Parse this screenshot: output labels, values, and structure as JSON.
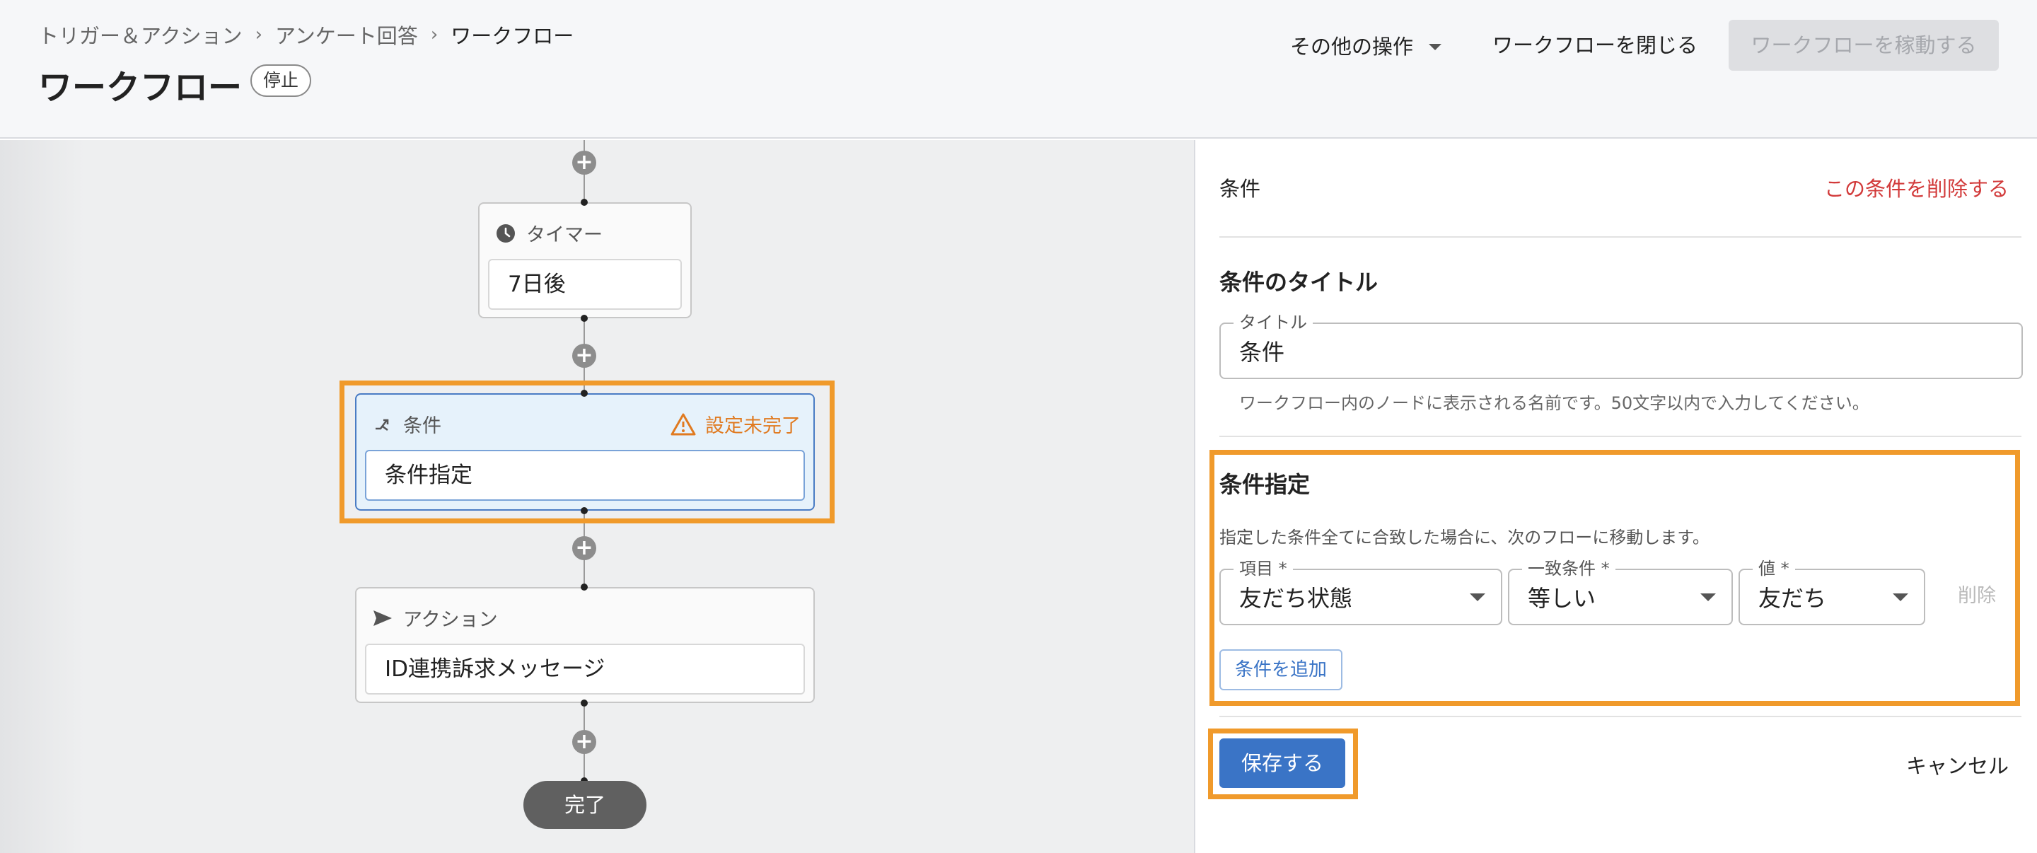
{
  "header": {
    "breadcrumb": [
      "トリガー＆アクション",
      "アンケート回答",
      "ワークフロー"
    ],
    "breadcrumb_separator": "›",
    "title": "ワークフロー",
    "status": "停止",
    "other_actions": "その他の操作",
    "close_workflow": "ワークフローを閉じる",
    "run_workflow": "ワークフローを稼動する"
  },
  "canvas": {
    "timer_node": {
      "type_label": "タイマー",
      "value": "7日後"
    },
    "condition_node": {
      "type_label": "条件",
      "warning": "設定未完了",
      "value": "条件指定"
    },
    "action_node": {
      "type_label": "アクション",
      "value": "ID連携訴求メッセージ"
    },
    "end_label": "完了",
    "add_symbol": "+"
  },
  "panel": {
    "label": "条件",
    "delete_condition": "この条件を削除する",
    "title_section": {
      "heading": "条件のタイトル",
      "field_legend": "タイトル",
      "field_value": "条件",
      "helper": "ワークフロー内のノードに表示される名前です。50文字以内で入力してください。"
    },
    "spec_section": {
      "heading": "条件指定",
      "description": "指定した条件全てに合致した場合に、次のフローに移動します。",
      "item_legend": "項目 *",
      "item_value": "友だち状態",
      "match_legend": "一致条件 *",
      "match_value": "等しい",
      "value_legend": "値 *",
      "value_value": "友だち",
      "row_delete": "削除",
      "add_condition": "条件を追加"
    },
    "save": "保存する",
    "cancel": "キャンセル"
  },
  "colors": {
    "accent": "#3a74c6",
    "highlight": "#f09a2b",
    "warning": "#e07a20",
    "danger": "#d23a3a"
  },
  "icons": [
    "clock-icon",
    "branch-icon",
    "warning-icon",
    "send-icon",
    "plus-icon",
    "chevron-down-icon"
  ]
}
